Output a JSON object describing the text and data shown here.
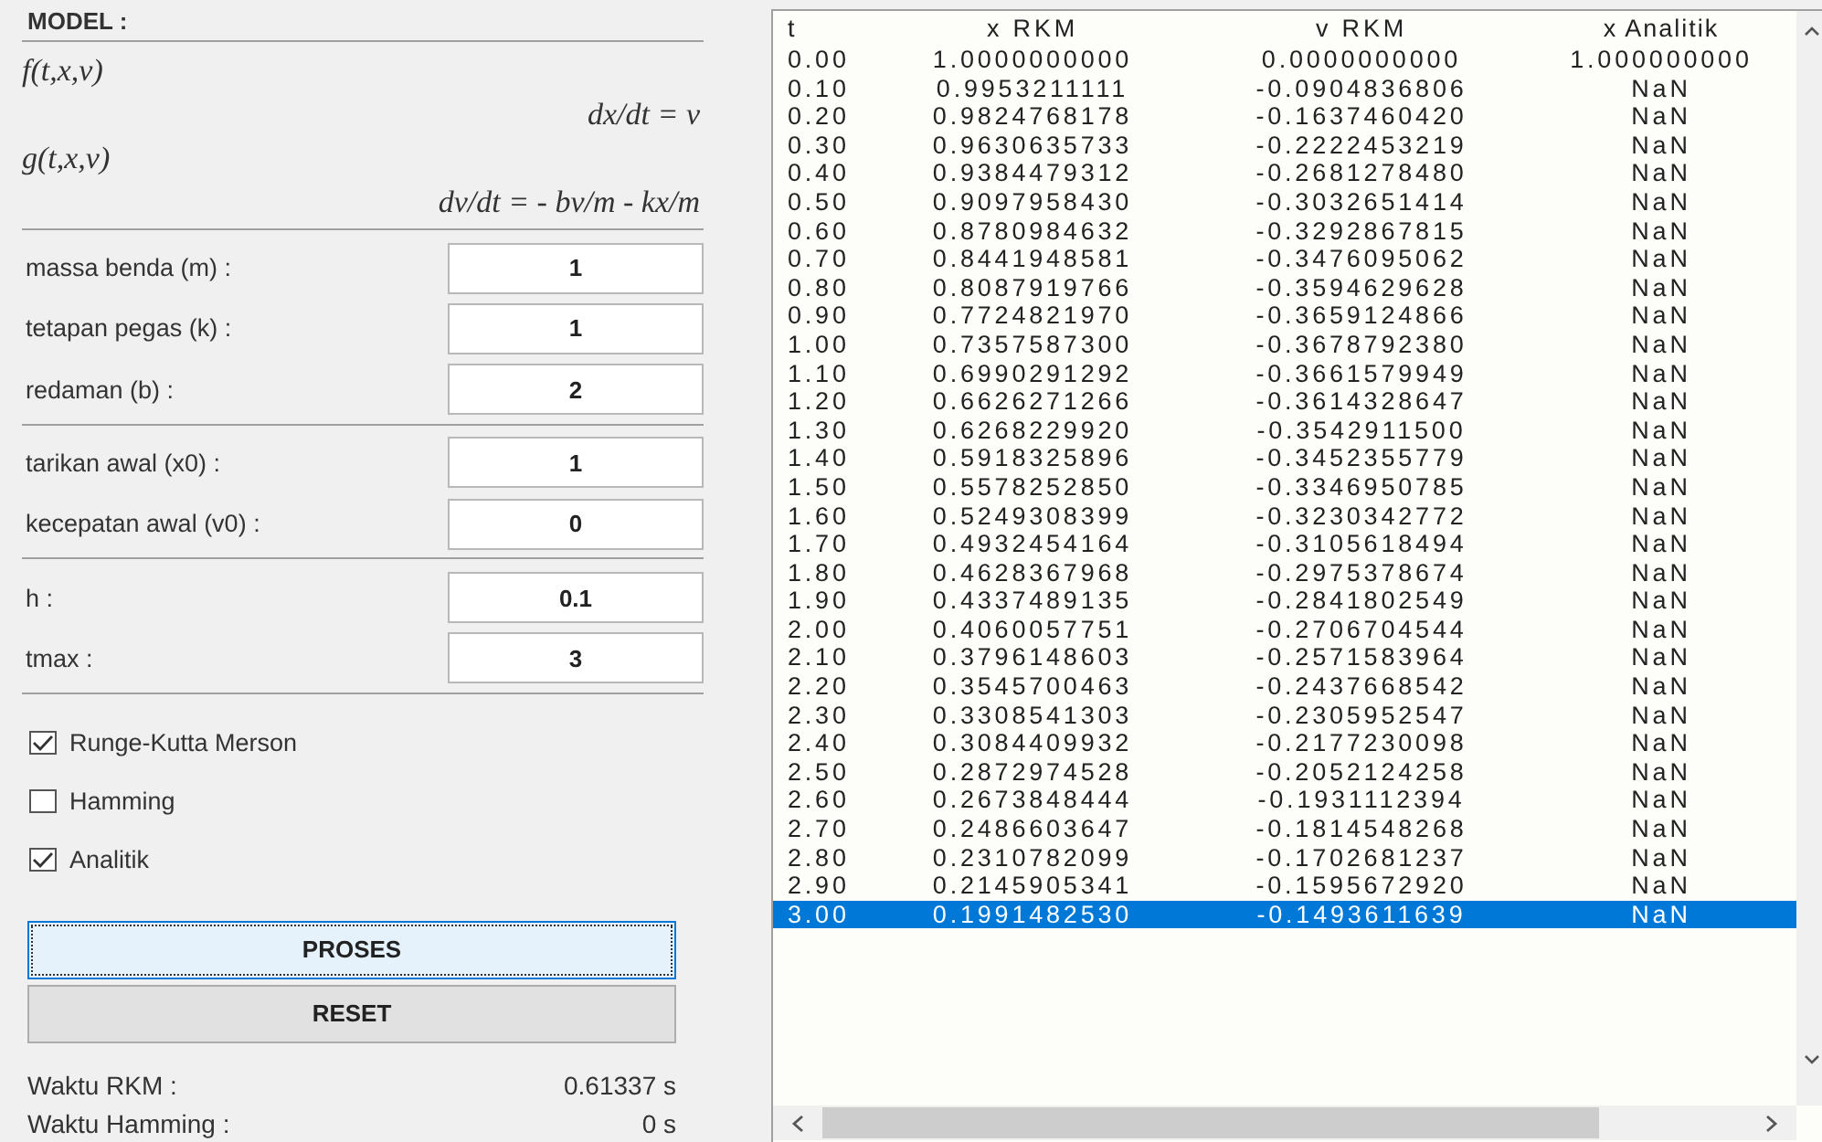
{
  "model": {
    "title": "MODEL :",
    "equations": [
      {
        "kind": "name",
        "text": "f(t,x,v)"
      },
      {
        "kind": "formula",
        "text": "dx/dt = v"
      },
      {
        "kind": "name",
        "text": "g(t,x,v)"
      },
      {
        "kind": "formula",
        "text": "dv/dt = - bv/m - kx/m"
      }
    ]
  },
  "parameter_groups": [
    [
      {
        "label": "massa benda (m) :",
        "value": "1"
      },
      {
        "label": "tetapan pegas (k) :",
        "value": "1"
      },
      {
        "label": "redaman (b) :",
        "value": "2"
      }
    ],
    [
      {
        "label": "tarikan awal (x0) :",
        "value": "1"
      },
      {
        "label": "kecepatan awal (v0) :",
        "value": "0"
      }
    ],
    [
      {
        "label": "h :",
        "value": "0.1"
      },
      {
        "label": "tmax :",
        "value": "3"
      }
    ]
  ],
  "checkboxes": [
    {
      "label": "Runge-Kutta Merson",
      "checked": true
    },
    {
      "label": "Hamming",
      "checked": false
    },
    {
      "label": "Analitik",
      "checked": true
    }
  ],
  "buttons": [
    {
      "label": "PROSES",
      "focused": true
    },
    {
      "label": "RESET",
      "focused": false
    }
  ],
  "timings": [
    {
      "label": "Waktu RKM :",
      "value": "0.61337 s"
    },
    {
      "label": "Waktu Hamming :",
      "value": "0 s"
    }
  ],
  "table": {
    "columns": [
      "t",
      "x RKM",
      "v RKM",
      "x Analitik"
    ],
    "rows": [
      {
        "cells": [
          "0.00",
          "1.0000000000",
          "0.0000000000",
          "1.000000000"
        ],
        "selected": false
      },
      {
        "cells": [
          "0.10",
          "0.9953211111",
          "-0.0904836806",
          "NaN"
        ],
        "selected": false
      },
      {
        "cells": [
          "0.20",
          "0.9824768178",
          "-0.1637460420",
          "NaN"
        ],
        "selected": false
      },
      {
        "cells": [
          "0.30",
          "0.9630635733",
          "-0.2222453219",
          "NaN"
        ],
        "selected": false
      },
      {
        "cells": [
          "0.40",
          "0.9384479312",
          "-0.2681278480",
          "NaN"
        ],
        "selected": false
      },
      {
        "cells": [
          "0.50",
          "0.9097958430",
          "-0.3032651414",
          "NaN"
        ],
        "selected": false
      },
      {
        "cells": [
          "0.60",
          "0.8780984632",
          "-0.3292867815",
          "NaN"
        ],
        "selected": false
      },
      {
        "cells": [
          "0.70",
          "0.8441948581",
          "-0.3476095062",
          "NaN"
        ],
        "selected": false
      },
      {
        "cells": [
          "0.80",
          "0.8087919766",
          "-0.3594629628",
          "NaN"
        ],
        "selected": false
      },
      {
        "cells": [
          "0.90",
          "0.7724821970",
          "-0.3659124866",
          "NaN"
        ],
        "selected": false
      },
      {
        "cells": [
          "1.00",
          "0.7357587300",
          "-0.3678792380",
          "NaN"
        ],
        "selected": false
      },
      {
        "cells": [
          "1.10",
          "0.6990291292",
          "-0.3661579949",
          "NaN"
        ],
        "selected": false
      },
      {
        "cells": [
          "1.20",
          "0.6626271266",
          "-0.3614328647",
          "NaN"
        ],
        "selected": false
      },
      {
        "cells": [
          "1.30",
          "0.6268229920",
          "-0.3542911500",
          "NaN"
        ],
        "selected": false
      },
      {
        "cells": [
          "1.40",
          "0.5918325896",
          "-0.3452355779",
          "NaN"
        ],
        "selected": false
      },
      {
        "cells": [
          "1.50",
          "0.5578252850",
          "-0.3346950785",
          "NaN"
        ],
        "selected": false
      },
      {
        "cells": [
          "1.60",
          "0.5249308399",
          "-0.3230342772",
          "NaN"
        ],
        "selected": false
      },
      {
        "cells": [
          "1.70",
          "0.4932454164",
          "-0.3105618494",
          "NaN"
        ],
        "selected": false
      },
      {
        "cells": [
          "1.80",
          "0.4628367968",
          "-0.2975378674",
          "NaN"
        ],
        "selected": false
      },
      {
        "cells": [
          "1.90",
          "0.4337489135",
          "-0.2841802549",
          "NaN"
        ],
        "selected": false
      },
      {
        "cells": [
          "2.00",
          "0.4060057751",
          "-0.2706704544",
          "NaN"
        ],
        "selected": false
      },
      {
        "cells": [
          "2.10",
          "0.3796148603",
          "-0.2571583964",
          "NaN"
        ],
        "selected": false
      },
      {
        "cells": [
          "2.20",
          "0.3545700463",
          "-0.2437668542",
          "NaN"
        ],
        "selected": false
      },
      {
        "cells": [
          "2.30",
          "0.3308541303",
          "-0.2305952547",
          "NaN"
        ],
        "selected": false
      },
      {
        "cells": [
          "2.40",
          "0.3084409932",
          "-0.2177230098",
          "NaN"
        ],
        "selected": false
      },
      {
        "cells": [
          "2.50",
          "0.2872974528",
          "-0.2052124258",
          "NaN"
        ],
        "selected": false
      },
      {
        "cells": [
          "2.60",
          "0.2673848444",
          "-0.1931112394",
          "NaN"
        ],
        "selected": false
      },
      {
        "cells": [
          "2.70",
          "0.2486603647",
          "-0.1814548268",
          "NaN"
        ],
        "selected": false
      },
      {
        "cells": [
          "2.80",
          "0.2310782099",
          "-0.1702681237",
          "NaN"
        ],
        "selected": false
      },
      {
        "cells": [
          "2.90",
          "0.2145905341",
          "-0.1595672920",
          "NaN"
        ],
        "selected": false
      },
      {
        "cells": [
          "3.00",
          "0.1991482530",
          "-0.1493611639",
          "NaN"
        ],
        "selected": true
      }
    ]
  }
}
